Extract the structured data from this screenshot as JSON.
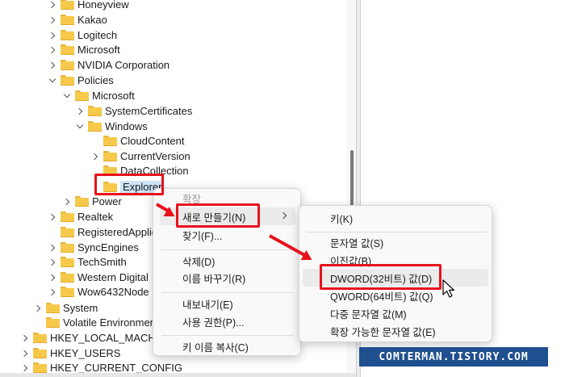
{
  "tree": {
    "nodes": [
      {
        "label": "Honeyview",
        "expander": "right",
        "selected": false
      },
      {
        "label": "Kakao",
        "expander": "right",
        "selected": false
      },
      {
        "label": "Logitech",
        "expander": "right",
        "selected": false
      },
      {
        "label": "Microsoft",
        "expander": "right",
        "selected": false
      },
      {
        "label": "NVIDIA Corporation",
        "expander": "right",
        "selected": false
      },
      {
        "label": "Policies",
        "expander": "down",
        "selected": false
      },
      {
        "label": "Microsoft",
        "expander": "down",
        "selected": false
      },
      {
        "label": "SystemCertificates",
        "expander": "right",
        "selected": false
      },
      {
        "label": "Windows",
        "expander": "down",
        "selected": false
      },
      {
        "label": "CloudContent",
        "expander": "none",
        "selected": false
      },
      {
        "label": "CurrentVersion",
        "expander": "right",
        "selected": false
      },
      {
        "label": "DataCollection",
        "expander": "none",
        "selected": false
      },
      {
        "label": "Explorer",
        "expander": "none",
        "selected": true
      },
      {
        "label": "Power",
        "expander": "right",
        "selected": false
      },
      {
        "label": "Realtek",
        "expander": "right",
        "selected": false
      },
      {
        "label": "RegisteredApplications",
        "expander": "none",
        "selected": false
      },
      {
        "label": "SyncEngines",
        "expander": "right",
        "selected": false
      },
      {
        "label": "TechSmith",
        "expander": "right",
        "selected": false
      },
      {
        "label": "Western Digital",
        "expander": "right",
        "selected": false
      },
      {
        "label": "Wow6432Node",
        "expander": "right",
        "selected": false
      },
      {
        "label": "System",
        "expander": "right",
        "selected": false
      },
      {
        "label": "Volatile Environment",
        "expander": "none",
        "selected": false
      },
      {
        "label": "HKEY_LOCAL_MACHINE",
        "expander": "right",
        "selected": false
      },
      {
        "label": "HKEY_USERS",
        "expander": "right",
        "selected": false
      },
      {
        "label": "HKEY_CURRENT_CONFIG",
        "expander": "right",
        "selected": false
      }
    ]
  },
  "context_menu": {
    "expand_label": "확장",
    "new_label": "새로 만들기(N)",
    "find_label": "찾기(F)...",
    "delete_label": "삭제(D)",
    "rename_label": "이름 바꾸기(R)",
    "export_label": "내보내기(E)",
    "permissions_label": "사용 권한(P)...",
    "copy_key_name_label": "키 이름 복사(C)"
  },
  "submenu": {
    "key_label": "키(K)",
    "string_label": "문자열 값(S)",
    "binary_label": "이진값(B)",
    "dword_label": "DWORD(32비트) 값(D)",
    "qword_label": "QWORD(64비트) 값(Q)",
    "multi_string_label": "다중 문자열 값(M)",
    "expandable_string_label": "확장 가능한 문자열 값(E)"
  },
  "watermark": {
    "text": "COMTERMAN.TISTORY.COM"
  },
  "colors": {
    "highlight_red": "#e8121b",
    "folder_yellow": "#f6c94a",
    "selection_blue": "#cce4f7",
    "watermark_bg": "#1f4f8f"
  }
}
